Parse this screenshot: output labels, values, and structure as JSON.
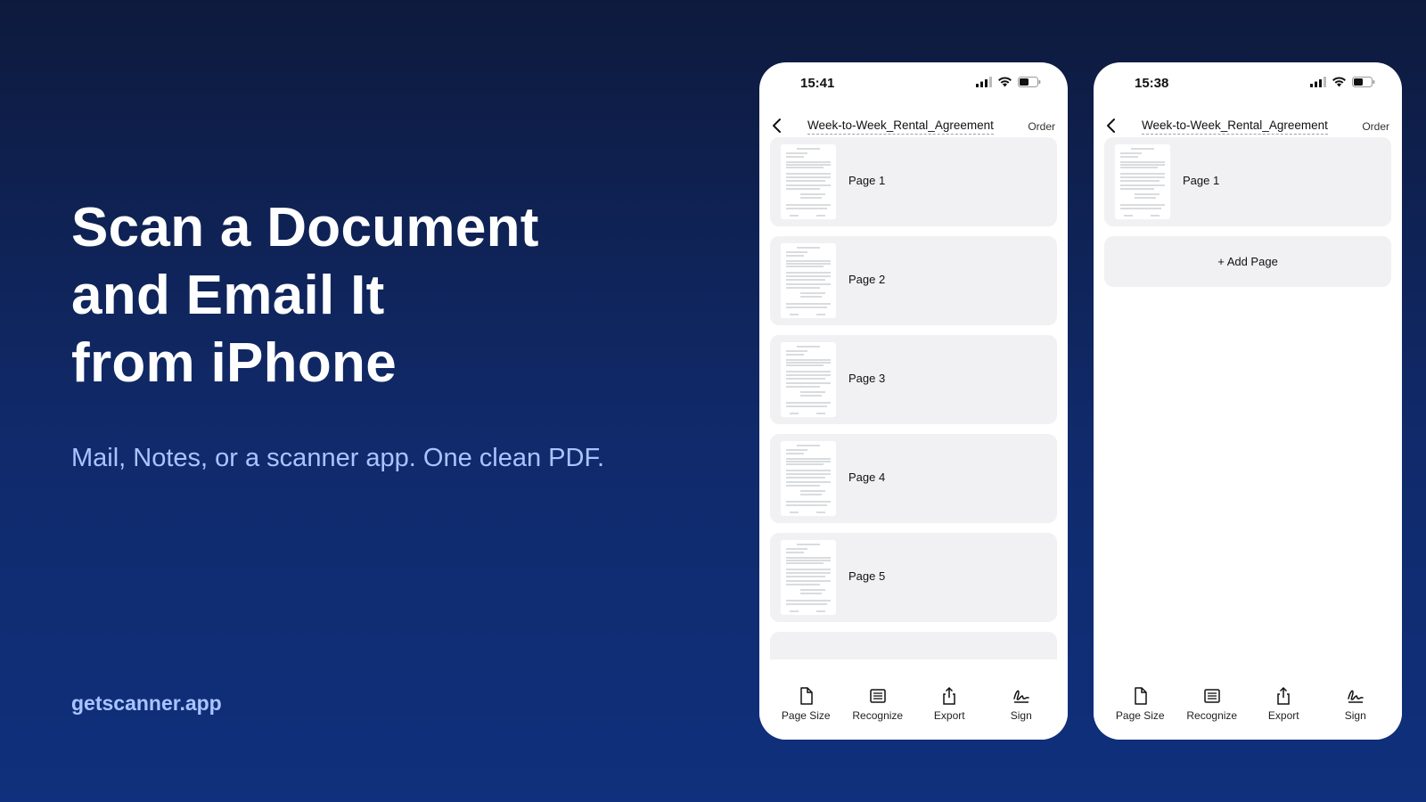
{
  "hero": {
    "title_lines": [
      "Scan a Document",
      "and Email It",
      "from iPhone"
    ],
    "subtitle": "Mail, Notes, or a scanner app. One clean PDF."
  },
  "footer": {
    "url": "getscanner.app"
  },
  "phones": [
    {
      "status_time": "15:41",
      "title": "Week-to-Week_Rental_Agreement",
      "order_label": "Order",
      "pages": [
        "Page 1",
        "Page 2",
        "Page 3",
        "Page 4",
        "Page 5"
      ],
      "toolbar": [
        "Page Size",
        "Recognize",
        "Export",
        "Sign"
      ]
    },
    {
      "status_time": "15:38",
      "title": "Week-to-Week_Rental_Agreement",
      "order_label": "Order",
      "pages": [
        "Page 1"
      ],
      "add_page_label": "+ Add Page",
      "toolbar": [
        "Page Size",
        "Recognize",
        "Export",
        "Sign"
      ]
    }
  ],
  "icons": {
    "back": "chevron-left-icon",
    "signal": "cellular-signal-icon",
    "wifi": "wifi-icon",
    "battery": "battery-icon",
    "page_size": "document-icon",
    "recognize": "text-lines-icon",
    "export": "share-icon",
    "sign": "signature-icon"
  }
}
